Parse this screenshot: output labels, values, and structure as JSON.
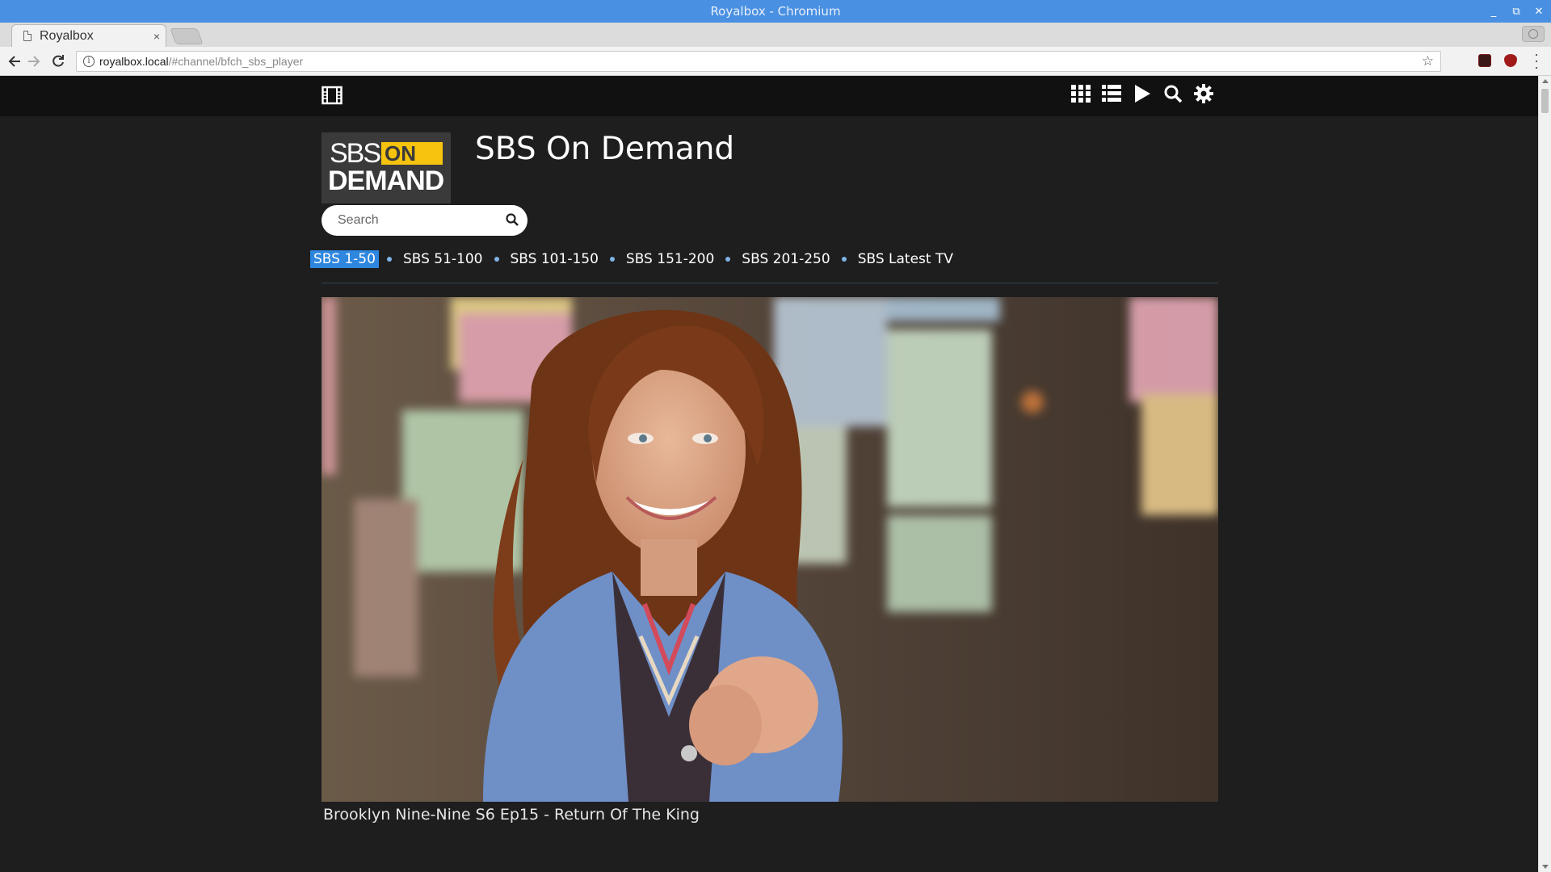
{
  "window": {
    "title": "Royalbox - Chromium",
    "controls": [
      "_",
      "⧉",
      "✕"
    ]
  },
  "browser": {
    "tab": {
      "title": "Royalbox",
      "close": "×"
    },
    "url": {
      "host": "royalbox.local",
      "path": "/#channel/bfch_sbs_player"
    }
  },
  "header": {
    "icons": [
      "film-icon",
      "grid-icon",
      "list-icon",
      "play-icon",
      "search-icon",
      "gear-icon"
    ]
  },
  "channel": {
    "logo": {
      "line1": "SBS",
      "badge": "ON",
      "line2": "DEMAND"
    },
    "title": "SBS On Demand",
    "search_placeholder": "Search",
    "tabs": [
      {
        "label": "SBS 1-50",
        "active": true
      },
      {
        "label": "SBS 51-100",
        "active": false
      },
      {
        "label": "SBS 101-150",
        "active": false
      },
      {
        "label": "SBS 151-200",
        "active": false
      },
      {
        "label": "SBS 201-250",
        "active": false
      },
      {
        "label": "SBS Latest TV",
        "active": false
      }
    ]
  },
  "featured": {
    "title": "Brooklyn Nine-Nine S6 Ep15 - Return Of The King"
  },
  "colors": {
    "titlebar": "#4a90e2",
    "page_bg": "#1e1e1e",
    "header_bg": "#111111",
    "active_tab": "#2e86de",
    "sbs_yellow": "#f6c30e"
  }
}
